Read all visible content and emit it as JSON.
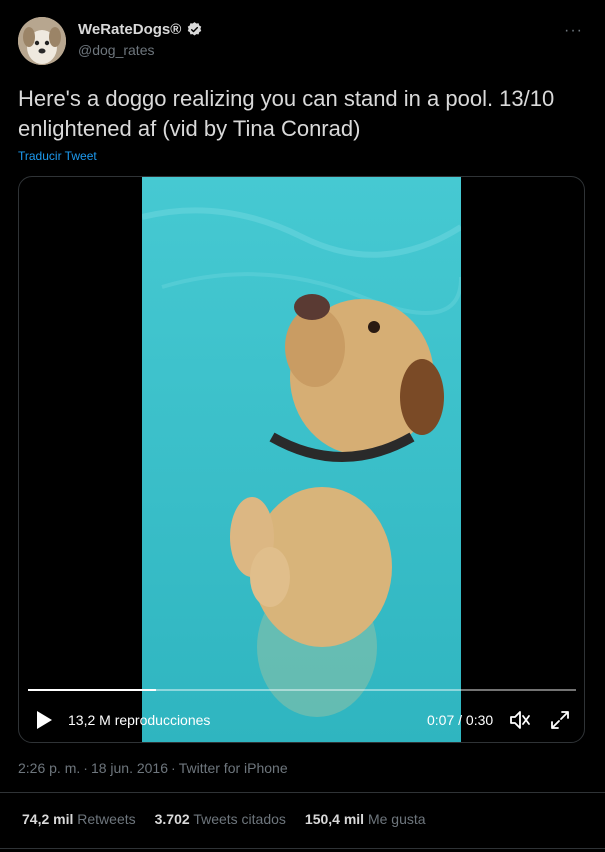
{
  "author": {
    "display_name": "WeRateDogs®",
    "handle": "@dog_rates",
    "verified": true
  },
  "more_menu": "···",
  "tweet": {
    "text": "Here's a doggo realizing you can stand in a pool. 13/10 enlightened af (vid by Tina Conrad)",
    "translate_label": "Traducir Tweet"
  },
  "video": {
    "views": "13,2 M reproducciones",
    "time": "0:07 / 0:30",
    "progress": 0.233
  },
  "meta": {
    "time": "2:26 p. m.",
    "date": "18 jun. 2016",
    "source": "Twitter for iPhone"
  },
  "stats": {
    "retweets_count": "74,2 mil",
    "retweets_label": "Retweets",
    "quotes_count": "3.702",
    "quotes_label": "Tweets citados",
    "likes_count": "150,4 mil",
    "likes_label": "Me gusta"
  },
  "colors": {
    "background": "#000000",
    "accent": "#1d9bf0",
    "pool": "#3fc4cc"
  },
  "icons": [
    "verified-badge-icon",
    "more-icon",
    "play-icon",
    "volume-icon",
    "fullscreen-icon"
  ]
}
